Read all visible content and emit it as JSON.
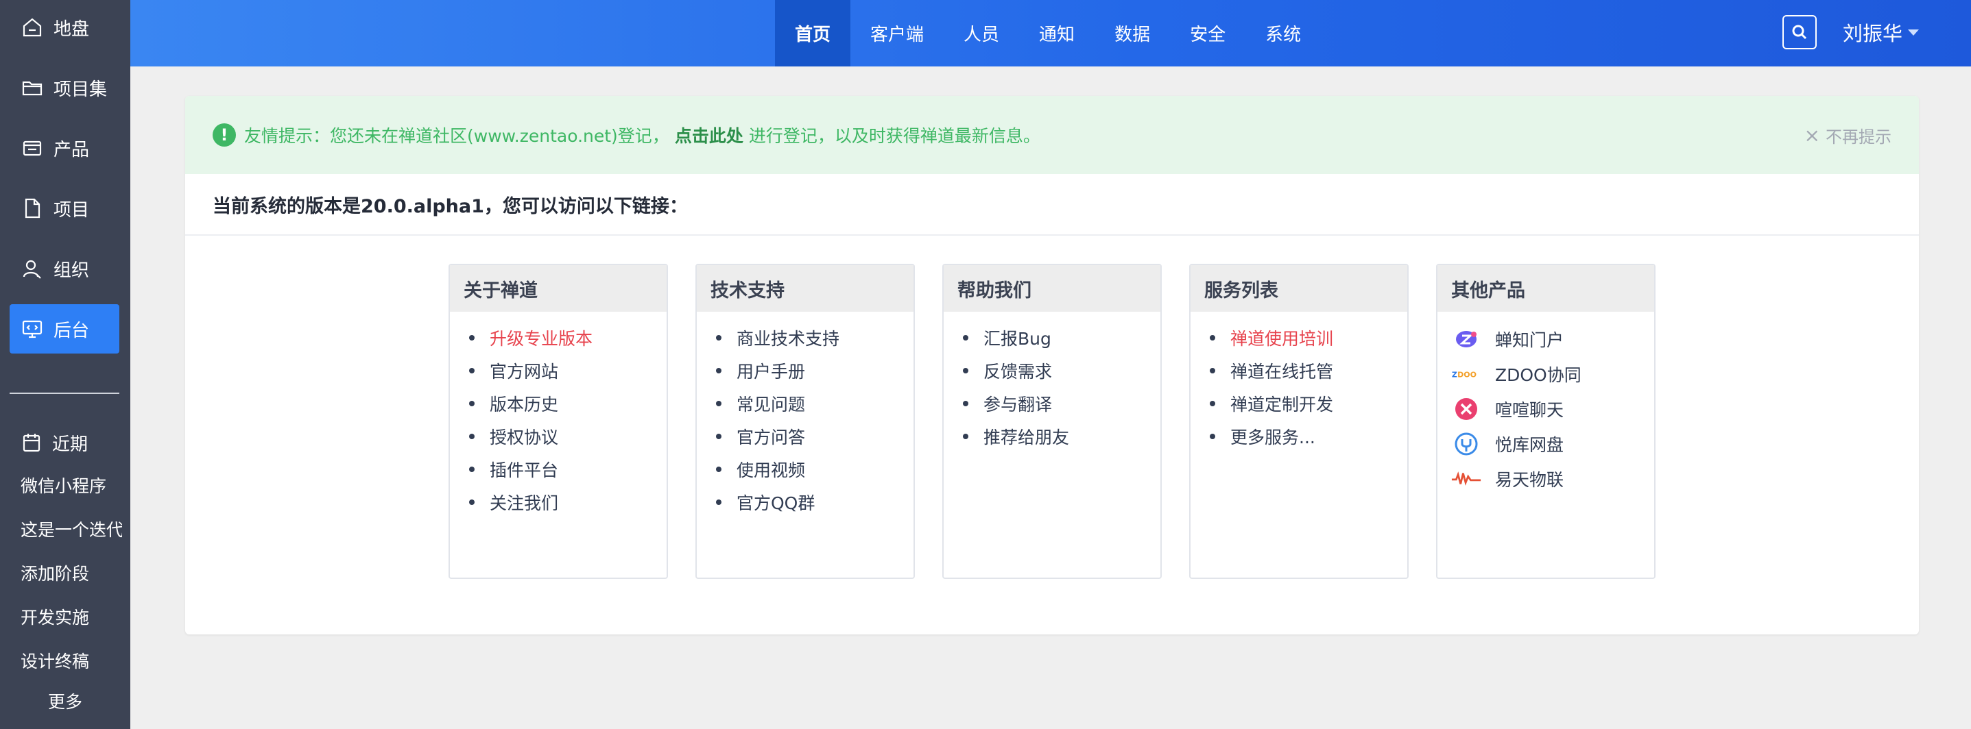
{
  "sidebar": {
    "items": [
      {
        "label": "地盘",
        "icon": "home-icon"
      },
      {
        "label": "项目集",
        "icon": "folder-icon"
      },
      {
        "label": "产品",
        "icon": "product-icon"
      },
      {
        "label": "项目",
        "icon": "file-icon"
      },
      {
        "label": "组织",
        "icon": "user-icon"
      },
      {
        "label": "后台",
        "icon": "admin-icon"
      }
    ],
    "recent_label": "近期",
    "recent_items": [
      "微信小程序",
      "这是一个迭代",
      "添加阶段",
      "开发实施",
      "设计终稿"
    ],
    "more_label": "更多"
  },
  "header": {
    "tabs": [
      "首页",
      "客户端",
      "人员",
      "通知",
      "数据",
      "安全",
      "系统"
    ],
    "active_tab": "首页",
    "user_name": "刘振华"
  },
  "notice": {
    "prefix": "友情提示：您还未在禅道社区(www.zentao.net)登记，",
    "link": "点击此处",
    "suffix": "进行登记，以及时获得禅道最新信息。",
    "dismiss": "不再提示"
  },
  "version_line": "当前系统的版本是20.0.alpha1，您可以访问以下链接：",
  "cards": [
    {
      "title": "关于禅道",
      "items": [
        "升级专业版本",
        "官方网站",
        "版本历史",
        "授权协议",
        "插件平台",
        "关注我们"
      ],
      "highlight": [
        0
      ]
    },
    {
      "title": "技术支持",
      "items": [
        "商业技术支持",
        "用户手册",
        "常见问题",
        "官方问答",
        "使用视频",
        "官方QQ群"
      ],
      "highlight": []
    },
    {
      "title": "帮助我们",
      "items": [
        "汇报Bug",
        "反馈需求",
        "参与翻译",
        "推荐给朋友"
      ],
      "highlight": []
    },
    {
      "title": "服务列表",
      "items": [
        "禅道使用培训",
        "禅道在线托管",
        "禅道定制开发",
        "更多服务..."
      ],
      "highlight": [
        0
      ]
    }
  ],
  "products": {
    "title": "其他产品",
    "items": [
      {
        "label": "蝉知门户",
        "icon": "chanzhi-icon"
      },
      {
        "label": "ZDOO协同",
        "icon": "zdoo-icon"
      },
      {
        "label": "喧喧聊天",
        "icon": "xuanxuan-icon"
      },
      {
        "label": "悦库网盘",
        "icon": "yueku-icon"
      },
      {
        "label": "易天物联",
        "icon": "yitian-icon"
      }
    ]
  },
  "colors": {
    "sidebar_bg": "#3c4354",
    "accent": "#2e7ff5",
    "notice_green": "#3eb764",
    "highlight_red": "#e7434d"
  }
}
